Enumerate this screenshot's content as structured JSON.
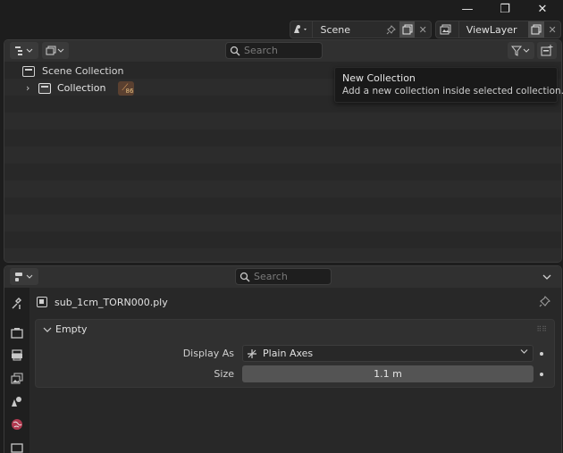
{
  "topbar": {
    "minimize_glyph": "—",
    "maximize_glyph": "❐",
    "close_glyph": "✕",
    "scene": {
      "name": "Scene",
      "icon": "scene-icon"
    },
    "view_layer": {
      "name": "ViewLayer",
      "icon": "view-layer-icon"
    }
  },
  "outliner": {
    "search_placeholder": "Search",
    "tree": [
      {
        "label": "Scene Collection",
        "icon": "collection-icon"
      },
      {
        "label": "Collection",
        "icon": "collection-icon",
        "expanded": false,
        "badge": "86"
      }
    ],
    "tooltip": {
      "title": "New Collection",
      "description": "Add a new collection inside selected collection."
    }
  },
  "properties": {
    "search_placeholder": "Search",
    "object_name": "sub_1cm_TORN000.ply",
    "panel": {
      "title": "Empty",
      "display_as_label": "Display As",
      "display_as_value": "Plain Axes",
      "size_label": "Size",
      "size_value": "1.1 m"
    }
  },
  "colors": {
    "background": "#1d1d1d",
    "editor_bg": "#282828",
    "header_bg": "#303030",
    "field_bg": "#545454",
    "badge_bg": "#5a4030"
  }
}
